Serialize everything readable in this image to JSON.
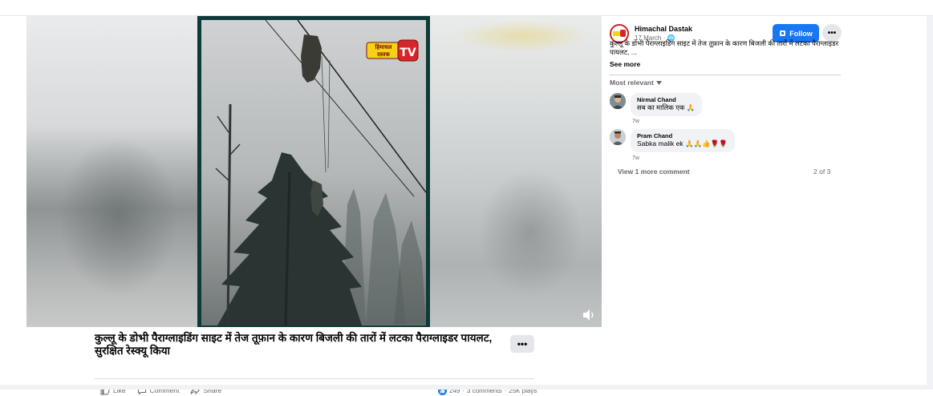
{
  "post": {
    "title": "कुल्लू के डोभी पैराग्लाइडिंग साइट में तेज तूफ़ान के कारण बिजली की तारों में लटका पैराग्लाइडर पायलट, सुरक्षित रेस्क्यू किया",
    "more_label": "•••",
    "actions": {
      "like": "Like",
      "comment": "Comment",
      "share": "Share"
    },
    "stats": {
      "reactions": "249",
      "separator1": "·",
      "comments": "3 comments",
      "separator2": "·",
      "plays": "25K plays"
    }
  },
  "video": {
    "logo_line1": "हिमाचल",
    "logo_line2": "दस्तक",
    "logo_tv": "TV"
  },
  "sidebar": {
    "page_name": "Himachal Dastak",
    "post_meta": "17 March · 🌐",
    "follow_label": "Follow",
    "more_label": "•••",
    "post_text": "कुल्लू के डोभी पैराग्लाइडिंग साइट में तेज तूफ़ान के कारण बिजली की तारों में लटका पैराग्लाइडर पायलट, ...",
    "see_more": "See more",
    "sort_label": "Most relevant",
    "comments": [
      {
        "name": "Nirmal Chand",
        "text": "सब का मालिक एक 🙏",
        "time": "7w"
      },
      {
        "name": "Pram Chand",
        "text": "Sabka malik ek 🙏🙏👍🌹🌹",
        "time": "7w"
      }
    ],
    "view_more": "View 1 more comment",
    "pager": "2 of 3"
  },
  "colors": {
    "accent": "#1877f2",
    "frame": "#0e3b3a",
    "logo_red": "#d7262b",
    "logo_yellow": "#f7d117"
  }
}
